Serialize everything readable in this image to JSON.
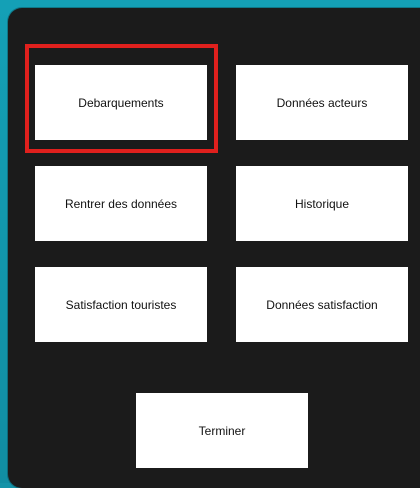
{
  "menu": {
    "buttons": [
      {
        "label": "Debarquements"
      },
      {
        "label": "Données acteurs"
      },
      {
        "label": "Rentrer des données"
      },
      {
        "label": "Historique"
      },
      {
        "label": "Satisfaction touristes"
      },
      {
        "label": "Données satisfaction"
      },
      {
        "label": "Terminer"
      }
    ],
    "selected": "Debarquements"
  },
  "colors": {
    "background": "#1493a8",
    "panel": "#1b1b1b",
    "button": "#ffffff",
    "highlight": "#e0201d"
  }
}
